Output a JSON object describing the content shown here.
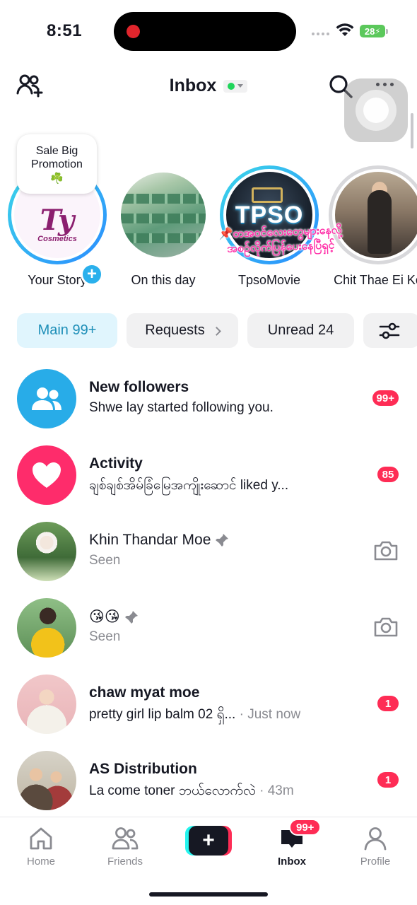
{
  "status_bar": {
    "time": "8:51",
    "battery": "28",
    "recording": true
  },
  "header": {
    "title": "Inbox",
    "status": "online",
    "accent_color": "#20d55b"
  },
  "stories": {
    "promo_bubble": {
      "line1": "Sale Big",
      "line2": "Promotion",
      "clover": "☘️"
    },
    "items": [
      {
        "name": "Your Story",
        "logo_big": "Ty",
        "logo_small": "Cosmetics",
        "ring": "blue",
        "has_add": true
      },
      {
        "name": "On this day",
        "ring": "none"
      },
      {
        "name": "TpsoMovie",
        "logo_text": "TPSO",
        "ring": "blue"
      },
      {
        "name": "Chit Thae Ei Ko",
        "ring": "gray"
      }
    ],
    "overlay_text_line1": "📌တအဝင်လေးတွေများနေလို့",
    "overlay_text_line2": "အစဉ်လိုက်ပြန်ပေးနေပြီရှင့်"
  },
  "tabs": [
    {
      "label": "Main 99+",
      "active": true
    },
    {
      "label": "Requests",
      "active": false,
      "has_chevron": true
    },
    {
      "label": "Unread 24",
      "active": false
    },
    {
      "label": "",
      "icon": "filter-sliders-icon",
      "active": false
    }
  ],
  "messages": [
    {
      "title": "New followers",
      "subtitle": "Shwe lay started following you.",
      "badge": "99+",
      "avatar": "followers-icon"
    },
    {
      "title": "Activity",
      "subtitle": "ချစ်ချစ်အိမ်ခြံမြေအကျိုးဆောင် liked y...",
      "badge": "85",
      "avatar": "heart-icon"
    },
    {
      "title": "Khin Thandar Moe",
      "subtitle": "Seen",
      "pinned": true,
      "action": "camera-icon"
    },
    {
      "title": "😘😘",
      "subtitle": "Seen",
      "pinned": true,
      "action": "camera-icon"
    },
    {
      "title": "chaw myat moe",
      "subtitle": "pretty girl lip balm 02 ရှိ...",
      "time": "· Just now",
      "badge": "1"
    },
    {
      "title": "AS Distribution",
      "subtitle": "La come toner ဘယ်လောက်လဲ",
      "time": "· 43m",
      "badge": "1"
    }
  ],
  "bottom_nav": {
    "items": [
      {
        "label": "Home",
        "icon": "home-icon",
        "active": false
      },
      {
        "label": "Friends",
        "icon": "friends-icon",
        "active": false
      },
      {
        "label": "",
        "icon": "create-plus-icon",
        "active": false
      },
      {
        "label": "Inbox",
        "icon": "inbox-icon",
        "active": true
      },
      {
        "label": "Profile",
        "icon": "profile-icon",
        "active": false
      }
    ],
    "inbox_badge": "99+",
    "create_symbol": "+"
  },
  "colors": {
    "brand_red": "#fe2c55",
    "brand_cyan": "#25f4ee",
    "text_primary": "#161823",
    "text_secondary": "#8a8b91",
    "tab_active_bg": "#e0f5fd",
    "tab_active_text": "#1e8fb8"
  }
}
